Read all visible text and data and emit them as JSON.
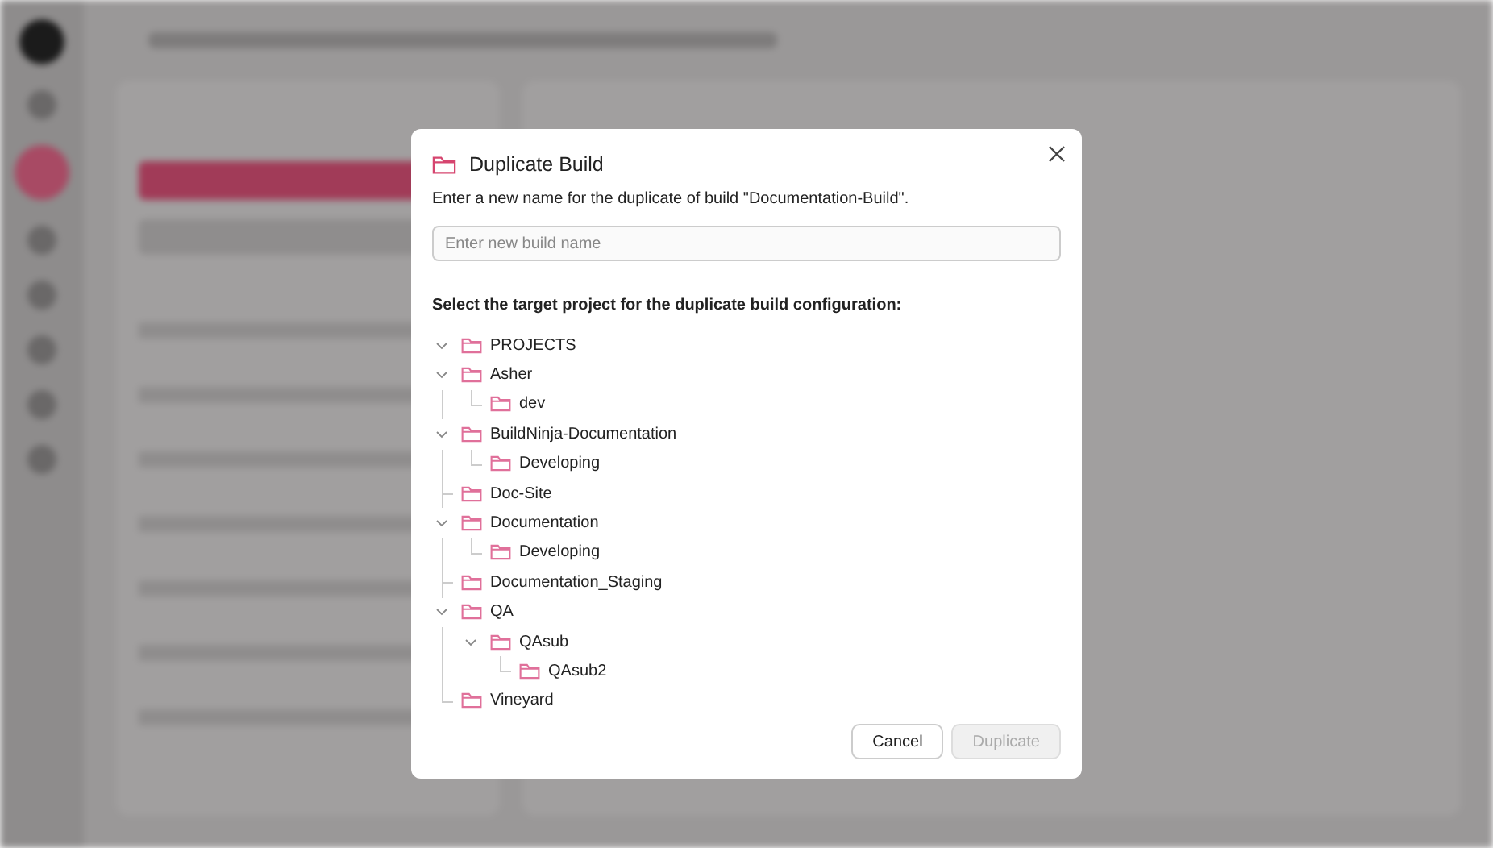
{
  "dialog": {
    "title": "Duplicate Build",
    "message": "Enter a new name for the duplicate of build \"Documentation-Build\".",
    "name_field": {
      "placeholder": "Enter new build name"
    },
    "tree_label": "Select the target project for the duplicate build configuration:",
    "tree": {
      "label": "PROJECTS",
      "expanded": true,
      "children": [
        {
          "label": "Asher",
          "expanded": true,
          "children": [
            {
              "label": "dev"
            }
          ]
        },
        {
          "label": "BuildNinja-Documentation",
          "expanded": true,
          "children": [
            {
              "label": "Developing"
            }
          ]
        },
        {
          "label": "Doc-Site"
        },
        {
          "label": "Documentation",
          "expanded": true,
          "children": [
            {
              "label": "Developing"
            }
          ]
        },
        {
          "label": "Documentation_Staging"
        },
        {
          "label": "QA",
          "expanded": true,
          "children": [
            {
              "label": "QAsub",
              "expanded": true,
              "children": [
                {
                  "label": "QAsub2"
                }
              ]
            }
          ]
        },
        {
          "label": "Vineyard"
        }
      ]
    },
    "buttons": [
      {
        "label": "Cancel",
        "kind": "secondary",
        "disabled": false
      },
      {
        "label": "Duplicate",
        "kind": "primary",
        "disabled": true
      }
    ]
  }
}
